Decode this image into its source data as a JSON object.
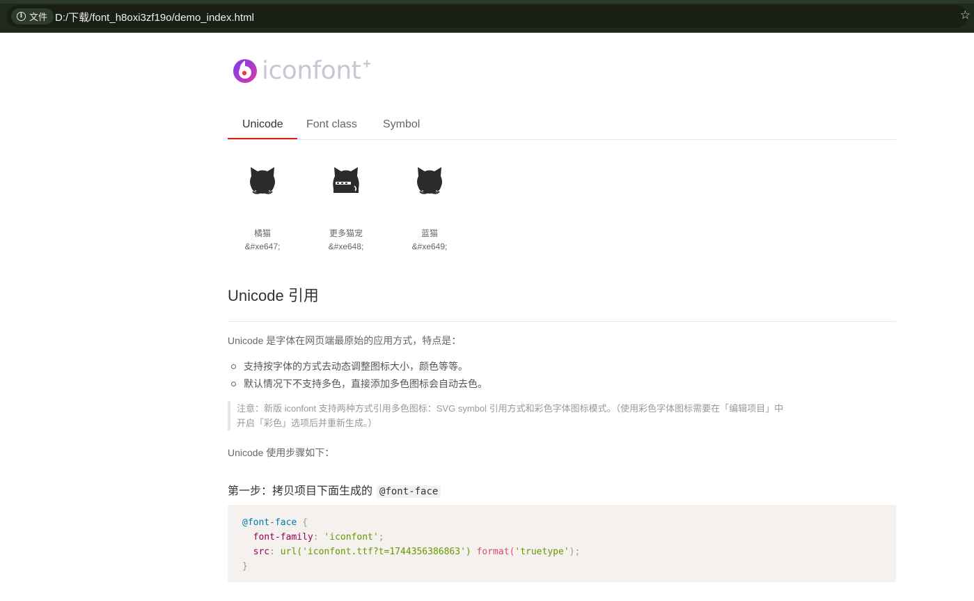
{
  "browser": {
    "security_label": "文件",
    "url": "D:/下载/font_h8oxi3zf19o/demo_index.html"
  },
  "logo": {
    "wordmark": "iconfont",
    "plus": "+"
  },
  "tabs": [
    {
      "label": "Unicode",
      "active": true
    },
    {
      "label": "Font class",
      "active": false
    },
    {
      "label": "Symbol",
      "active": false
    }
  ],
  "icons": [
    {
      "name": "橘猫",
      "code": "&#xe647;",
      "icon": "cat-icon"
    },
    {
      "name": "更多猫宠",
      "code": "&#xe648;",
      "icon": "cat-hat-icon"
    },
    {
      "name": "蓝猫",
      "code": "&#xe649;",
      "icon": "cat-icon"
    }
  ],
  "content": {
    "heading": "Unicode 引用",
    "intro": "Unicode 是字体在网页端最原始的应用方式，特点是：",
    "bullets": [
      "支持按字体的方式去动态调整图标大小，颜色等等。",
      "默认情况下不支持多色，直接添加多色图标会自动去色。"
    ],
    "note_line1": "注意：新版 iconfont 支持两种方式引用多色图标：SVG symbol 引用方式和彩色字体图标模式。（使用彩色字体图标需要在「编辑项目」中",
    "note_line2": "开启「彩色」选项后并重新生成。）",
    "steps_intro": "Unicode 使用步骤如下：",
    "step1_title": "第一步：拷贝项目下面生成的",
    "step1_code": "@font-face"
  },
  "code_block": {
    "l1_kw": "@font-face",
    "l1_brace": "{",
    "l2_prop": "font-family",
    "l2_colon": ":",
    "l2_val": "'iconfont'",
    "l2_semi": ";",
    "l3_prop": "src",
    "l3_colon": ":",
    "l3_url_fn": "url(",
    "l3_url_val": "'iconfont.ttf?t=1744356386863'",
    "l3_url_close": ")",
    "l3_format_fn": "format(",
    "l3_format_val": "'truetype'",
    "l3_format_close": ");",
    "l4_brace": "}"
  },
  "colors": {
    "accent": "#d81e06",
    "code_bg": "#f4f1ee",
    "topbar": "#1f2a1a"
  }
}
